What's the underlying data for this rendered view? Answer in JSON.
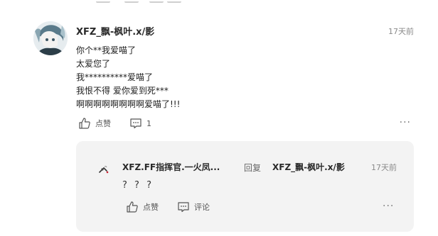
{
  "comment": {
    "username": "XFZ_飘-枫叶.x/影",
    "time": "17天前",
    "lines": [
      "你个**我爱喵了",
      "太爱您了",
      "我**********爱喵了",
      "我恨不得 爱你爱到死***",
      "啊啊啊啊啊啊啊啊爱喵了!!!"
    ],
    "like_label": "点赞",
    "reply_count": "1",
    "more": "···",
    "icons": {
      "like": "thumbs-up-icon",
      "comment": "comment-icon",
      "more": "more-dots-icon"
    }
  },
  "reply": {
    "username": "XFZ.FF指挥官.一火凤...",
    "reply_word": "回复",
    "target_user": "XFZ_飘-枫叶.x/影",
    "time": "17天前",
    "text": "? ? ?",
    "like_label": "点赞",
    "comment_label": "评论",
    "more": "···"
  }
}
